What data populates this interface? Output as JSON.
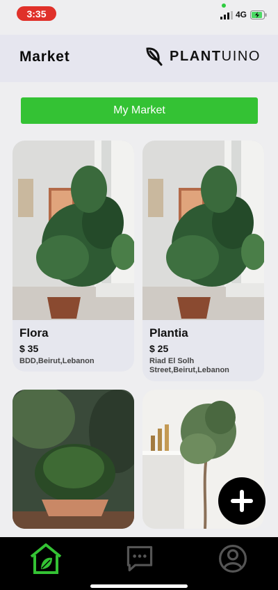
{
  "status_bar": {
    "time": "3:35",
    "network": "4G",
    "time_pill_color": "#e0312a"
  },
  "header": {
    "title": "Market",
    "logo_strong": "PLANT",
    "logo_light": "UINO"
  },
  "my_market_button": {
    "label": "My Market",
    "color": "#34c234"
  },
  "listings": [
    {
      "name": "Flora",
      "price": "$ 35",
      "location": "BDD,Beirut,Lebanon"
    },
    {
      "name": "Plantia",
      "price": "$ 25",
      "location": "Riad El Solh Street,Beirut,Lebanon"
    }
  ],
  "fab": {
    "icon": "plus-icon"
  },
  "bottom_nav": {
    "items": [
      {
        "icon": "home-icon",
        "active": true,
        "active_color": "#34c234"
      },
      {
        "icon": "chat-icon",
        "active": false
      },
      {
        "icon": "profile-icon",
        "active": false
      }
    ]
  }
}
